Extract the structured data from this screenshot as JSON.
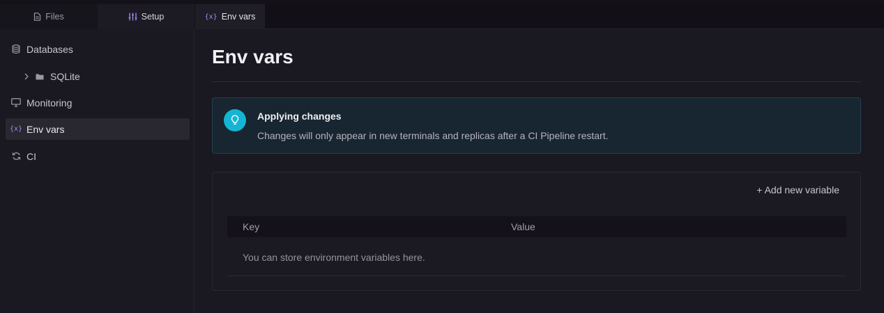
{
  "tabs": {
    "files": {
      "label": "Files",
      "icon": "file-icon"
    },
    "setup": {
      "label": "Setup",
      "icon": "sliders-icon"
    },
    "editor": {
      "label": "Env vars",
      "icon": "variable-icon",
      "icon_glyph": "{x}"
    }
  },
  "sidebar": {
    "items": [
      {
        "label": "Databases",
        "icon": "database-icon"
      },
      {
        "label": "SQLite",
        "icon": "folder-icon"
      },
      {
        "label": "Monitoring",
        "icon": "monitor-icon"
      },
      {
        "label": "Env vars",
        "icon": "variable-icon",
        "icon_glyph": "{x}",
        "active": true
      },
      {
        "label": "CI",
        "icon": "refresh-icon"
      }
    ]
  },
  "main": {
    "title": "Env vars",
    "callout": {
      "title": "Applying changes",
      "text": "Changes will only appear in new terminals and replicas after a CI Pipeline restart.",
      "icon": "lightbulb-icon"
    },
    "panel": {
      "add_label": "+ Add new variable",
      "columns": [
        "Key",
        "Value"
      ],
      "empty_text": "You can store environment variables here."
    }
  },
  "colors": {
    "background": "#1a1820",
    "accent_purple": "#a78bfa",
    "callout_icon": "#15b4d4"
  }
}
